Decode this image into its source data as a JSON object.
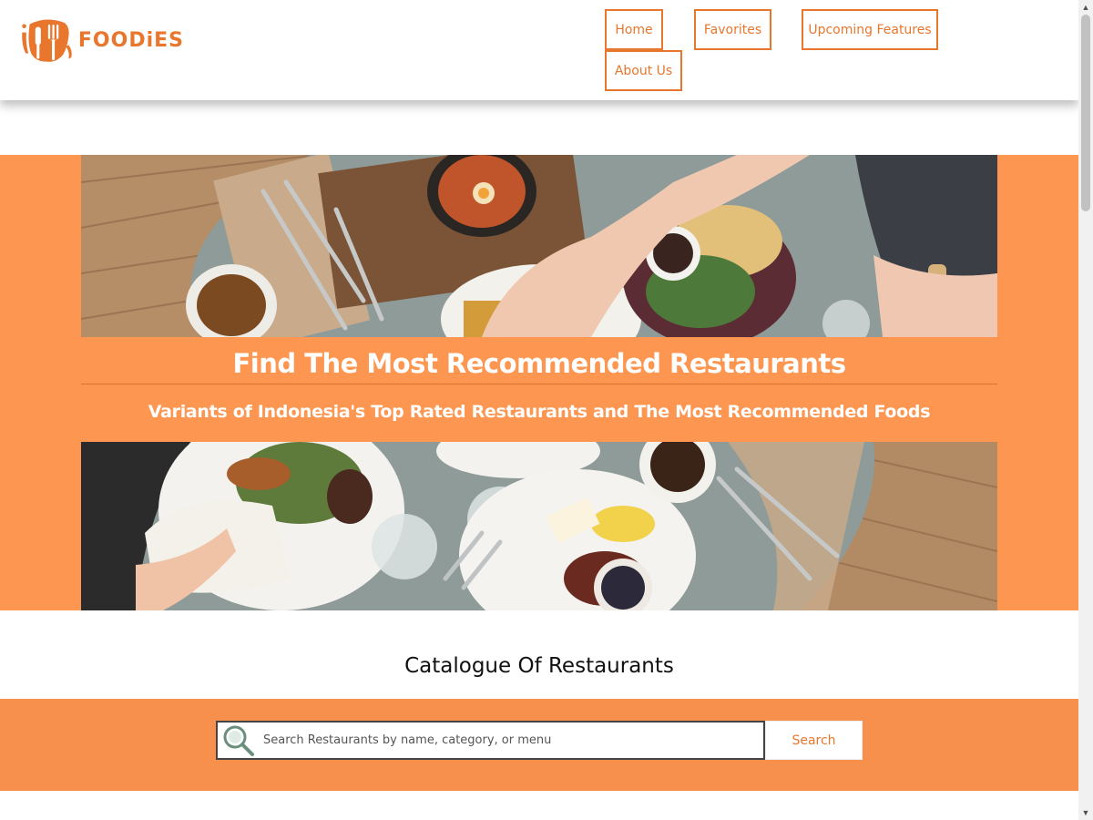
{
  "header": {
    "logo_text": "FOODiES",
    "nav": {
      "home": "Home",
      "favorites": "Favorites",
      "upcoming": "Upcoming Features",
      "about": "About Us"
    }
  },
  "hero": {
    "title": "Find The Most Recommended Restaurants",
    "subtitle": "Variants of Indonesia's Top Rated Restaurants and The Most Recommended Foods"
  },
  "catalogue": {
    "title": "Catalogue Of Restaurants",
    "search_placeholder": "Search Restaurants by name, category, or menu",
    "search_value": "",
    "search_button": "Search"
  },
  "colors": {
    "brand": "#e8762d",
    "hero_bg": "#fd9651",
    "search_band": "#f6904c"
  },
  "icons": [
    "logo-mark-icon",
    "search-icon",
    "scroll-up-icon",
    "scroll-down-icon"
  ]
}
